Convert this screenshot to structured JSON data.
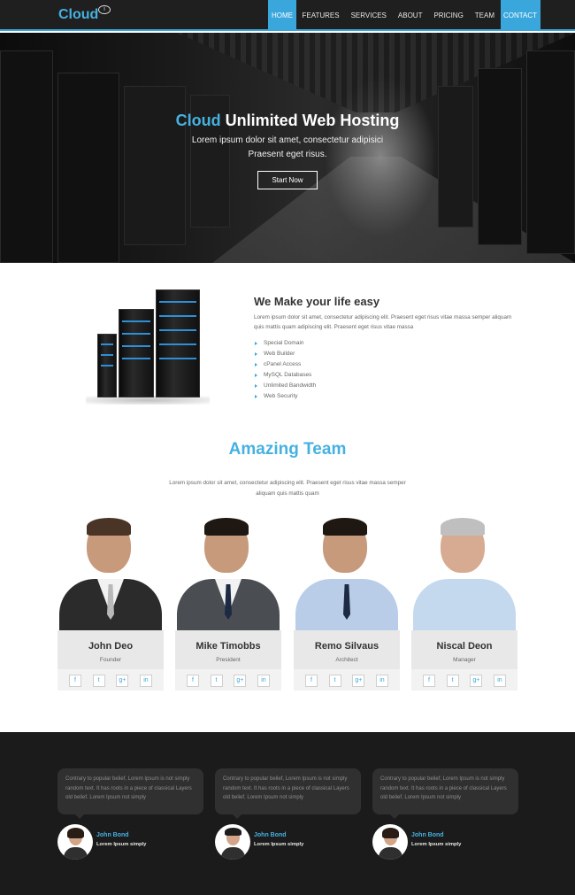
{
  "nav": {
    "logo": "Cloud",
    "logo_badge": "i",
    "items": [
      {
        "label": "HOME"
      },
      {
        "label": "FEATURES"
      },
      {
        "label": "SERVICES"
      },
      {
        "label": "ABOUT"
      },
      {
        "label": "PRICING"
      },
      {
        "label": "TEAM"
      },
      {
        "label": "CONTACT"
      }
    ]
  },
  "hero": {
    "title_accent": "Cloud",
    "title_rest": " Unlimited Web Hosting",
    "line1": "Lorem ipsum dolor sit amet, consectetur adipisici",
    "line2": "Praesent eget risus.",
    "button": "Start Now"
  },
  "features": {
    "title": "We Make your life easy",
    "text": "Lorem ipsum dolor sit amet, consectetur adipiscing elit. Praesent eget risus vitae massa semper aliquam quis mattis quam adipiscing elit. Praesent eget risus vitae massa",
    "items": [
      "Special Domain",
      "Web Builder",
      "cPanel Access",
      "MySQL Databases",
      "Unlimited Bandwidth",
      "Web Security"
    ]
  },
  "team": {
    "title": "Amazing Team",
    "text": "Lorem ipsum dolor sit amet, consectetur adipiscing elit. Praesent eget risus vitae massa semper aliquam quis mattis quam",
    "members": [
      {
        "name": "John Deo",
        "role": "Founder"
      },
      {
        "name": "Mike Timobbs",
        "role": "President"
      },
      {
        "name": "Remo Silvaus",
        "role": "Architect"
      },
      {
        "name": "Niscal Deon",
        "role": "Manager"
      }
    ],
    "social": [
      "f",
      "t",
      "g+",
      "in"
    ]
  },
  "testimonials": [
    {
      "text": "Contrary to popular belief, Lorem Ipsum is not simply random text. It has roots in a piece of classical Layers old belief. Lorem Ipsum not simply",
      "name": "John Bond",
      "role": "Lorem Ipsum simply"
    },
    {
      "text": "Contrary to popular belief, Lorem Ipsum is not simply random text. It has roots in a piece of classical Layers old belief. Lorem Ipsum not simply",
      "name": "John Bond",
      "role": "Lorem Ipsum simply"
    },
    {
      "text": "Contrary to popular belief, Lorem Ipsum is not simply random text. It has roots in a piece of classical Layers old belief. Lorem Ipsum not simply",
      "name": "John Bond",
      "role": "Lorem Ipsum simply"
    }
  ],
  "colors": {
    "accent": "#3aa7dc",
    "dark": "#1b1b1b",
    "nav": "#1f1f1f"
  }
}
